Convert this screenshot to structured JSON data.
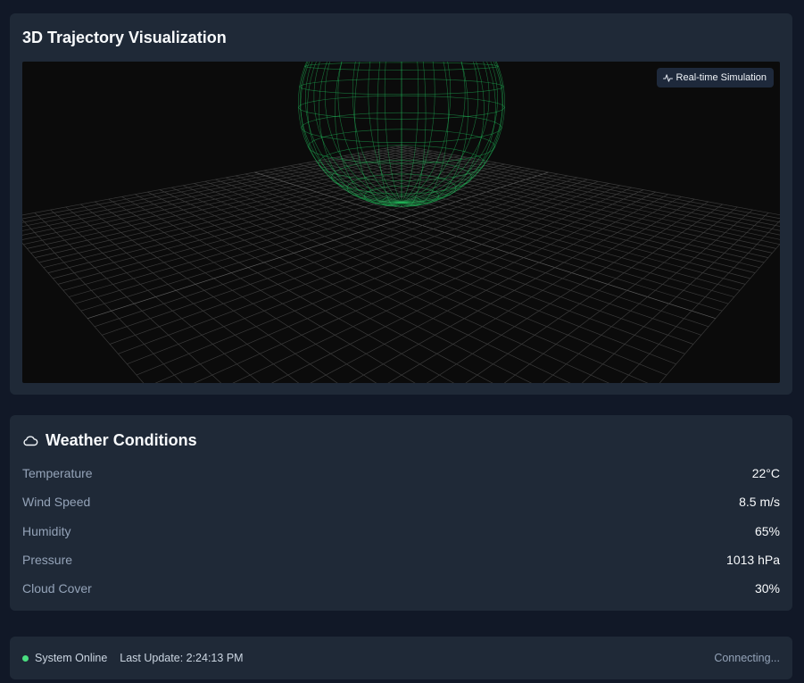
{
  "visualization": {
    "title": "3D Trajectory Visualization",
    "badge_label": "Real-time Simulation",
    "badge_icon": "activity-icon"
  },
  "weather": {
    "title": "Weather Conditions",
    "icon": "cloud-icon",
    "metrics": [
      {
        "label": "Temperature",
        "value": "22°C"
      },
      {
        "label": "Wind Speed",
        "value": "8.5 m/s"
      },
      {
        "label": "Humidity",
        "value": "65%"
      },
      {
        "label": "Pressure",
        "value": "1013 hPa"
      },
      {
        "label": "Cloud Cover",
        "value": "30%"
      }
    ]
  },
  "status": {
    "state": "System Online",
    "last_update": "Last Update: 2:24:13 PM",
    "connection": "Connecting..."
  },
  "colors": {
    "page_bg": "#111827",
    "card_bg": "#1f2937",
    "viewport_bg": "#0b0b0b",
    "sphere": "#22c55e",
    "online_dot": "#4ade80"
  }
}
